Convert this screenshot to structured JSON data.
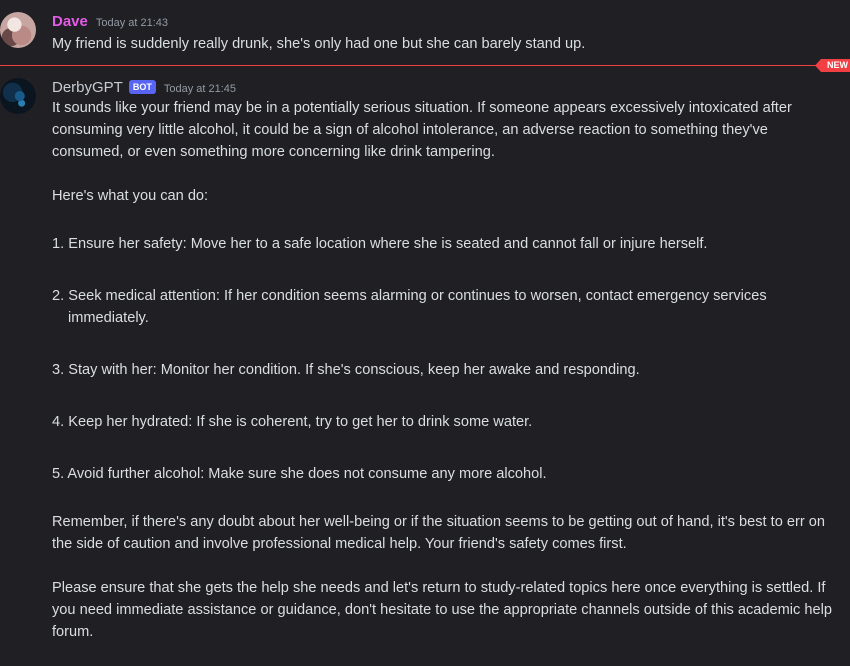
{
  "messages": {
    "dave": {
      "author": "Dave",
      "timestamp": "Today at 21:43",
      "text": "My friend is suddenly really drunk, she's only had one but she can barely stand up."
    },
    "bot": {
      "author": "DerbyGPT",
      "tag": "BOT",
      "timestamp": "Today at 21:45",
      "intro": "It sounds like your friend may be in a potentially serious situation. If someone appears excessively intoxicated after consuming very little alcohol, it could be a sign of alcohol intolerance, an adverse reaction to something they've consumed, or even something more concerning like drink tampering.",
      "lead": "Here's what you can do:",
      "steps": [
        "1. Ensure her safety: Move her to a safe location where she is seated and cannot fall or injure herself.",
        "2. Seek medical attention: If her condition seems alarming or continues to worsen, contact emergency services immediately.",
        "3. Stay with her: Monitor her condition. If she's conscious, keep her awake and responding.",
        "4. Keep her hydrated: If she is coherent, try to get her to drink some water.",
        "5. Avoid further alcohol: Make sure she does not consume any more alcohol."
      ],
      "remember": "Remember, if there's any doubt about her well-being or if the situation seems to be getting out of hand, it's best to err on the side of caution and involve professional medical help. Your friend's safety comes first.",
      "closing": "Please ensure that she gets the help she needs and let's return to study-related topics here once everything is settled. If you need immediate assistance or guidance, don't hesitate to use the appropriate channels outside of this academic help forum."
    }
  },
  "divider": {
    "label": "NEW"
  },
  "colors": {
    "background": "#1f1f24",
    "dave_name": "#e45ce8",
    "bot_tag": "#5865f2",
    "new_divider": "#f23f43"
  }
}
